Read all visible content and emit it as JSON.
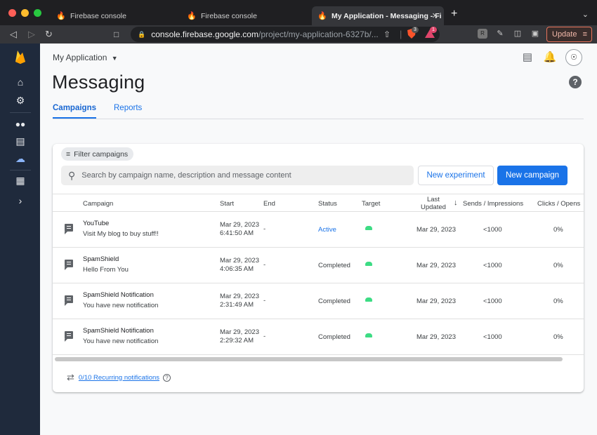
{
  "browser": {
    "tabs": [
      {
        "title": "Firebase console",
        "active": false
      },
      {
        "title": "Firebase console",
        "active": false
      },
      {
        "title": "My Application - Messaging - Fi",
        "active": true
      }
    ],
    "url_host": "console.firebase.google.com",
    "url_path": "/project/my-application-6327b/...",
    "shield_badge": "3",
    "alert_badge": "1",
    "update_label": "Update"
  },
  "header": {
    "project_name": "My Application",
    "page_title": "Messaging",
    "tabs": [
      {
        "label": "Campaigns",
        "active": true
      },
      {
        "label": "Reports",
        "active": false
      }
    ]
  },
  "toolbar": {
    "filter_label": "Filter campaigns",
    "search_placeholder": "Search by campaign name, description and message content",
    "new_experiment_label": "New experiment",
    "new_campaign_label": "New campaign"
  },
  "table": {
    "columns": {
      "campaign": "Campaign",
      "start": "Start",
      "end": "End",
      "status": "Status",
      "target": "Target",
      "updated_line1": "Last",
      "updated_line2": "Updated",
      "sends": "Sends / Impressions",
      "clicks": "Clicks / Opens"
    },
    "rows": [
      {
        "name": "YouTube",
        "description": "Visit My blog to buy stuff!!",
        "start_date": "Mar 29, 2023",
        "start_time": "6:41:50 AM",
        "end": "-",
        "status": "Active",
        "last_updated": "Mar 29, 2023",
        "sends": "<1000",
        "clicks": "0%"
      },
      {
        "name": "SpamShield",
        "description": "Hello From You",
        "start_date": "Mar 29, 2023",
        "start_time": "4:06:35 AM",
        "end": "-",
        "status": "Completed",
        "last_updated": "Mar 29, 2023",
        "sends": "<1000",
        "clicks": "0%"
      },
      {
        "name": "SpamShield Notification",
        "description": "You have new notification",
        "start_date": "Mar 29, 2023",
        "start_time": "2:31:49 AM",
        "end": "-",
        "status": "Completed",
        "last_updated": "Mar 29, 2023",
        "sends": "<1000",
        "clicks": "0%"
      },
      {
        "name": "SpamShield Notification",
        "description": "You have new notification",
        "start_date": "Mar 29, 2023",
        "start_time": "2:29:32 AM",
        "end": "-",
        "status": "Completed",
        "last_updated": "Mar 29, 2023",
        "sends": "<1000",
        "clicks": "0%"
      }
    ]
  },
  "footer": {
    "recurring_label": "0/10 Recurring notifications"
  },
  "colors": {
    "accent": "#1a73e8",
    "rail": "#1f2a3c",
    "android": "#3ddc84"
  }
}
